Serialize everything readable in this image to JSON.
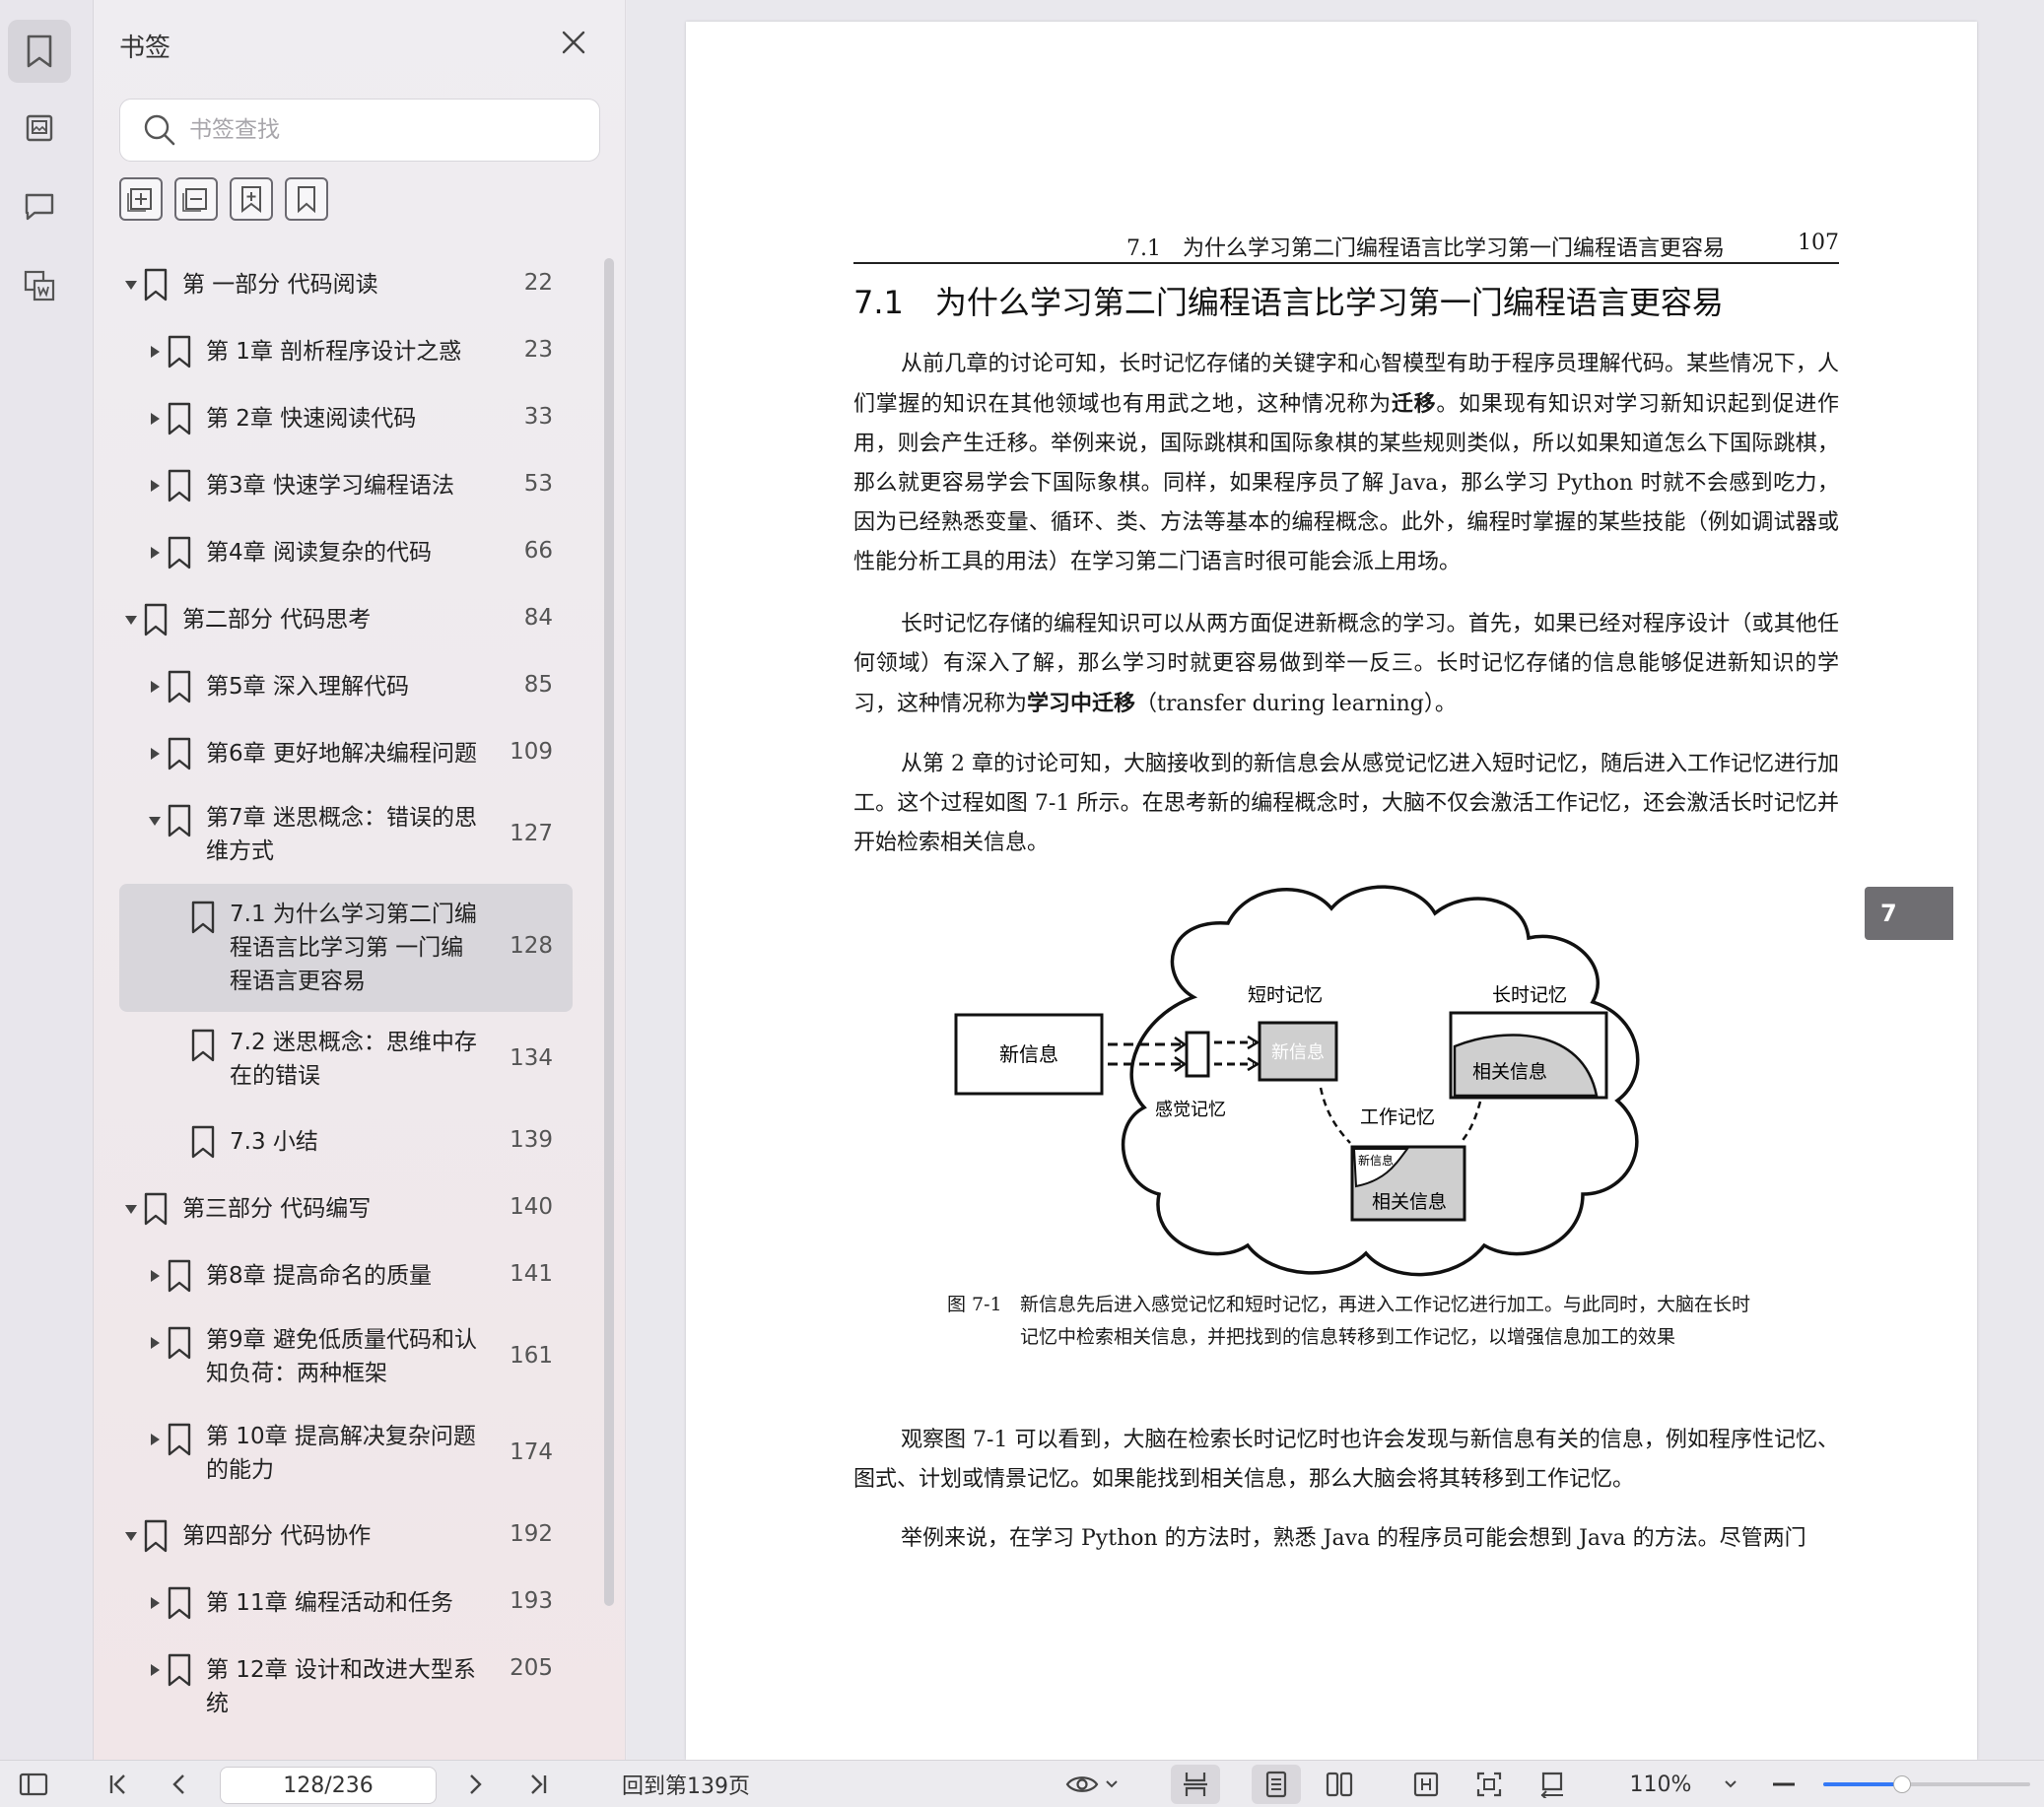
{
  "rail": {
    "items": [
      {
        "name": "bookmark-icon",
        "active": true
      },
      {
        "name": "thumbnail-icon",
        "active": false
      },
      {
        "name": "comment-icon",
        "active": false
      },
      {
        "name": "extract-icon",
        "active": false
      }
    ]
  },
  "sidebar": {
    "title": "书签",
    "search_placeholder": "书签查找",
    "tools": [
      "expand-all-icon",
      "collapse-all-icon",
      "add-bookmark-icon",
      "bookmark-icon"
    ],
    "items": [
      {
        "level": 0,
        "expanded": true,
        "label": "第 一部分 代码阅读",
        "page": "22"
      },
      {
        "level": 1,
        "expanded": false,
        "label": "第 1章 剖析程序设计之惑",
        "page": "23"
      },
      {
        "level": 1,
        "expanded": false,
        "label": "第 2章 快速阅读代码",
        "page": "33"
      },
      {
        "level": 1,
        "expanded": false,
        "label": "第3章 快速学习编程语法",
        "page": "53"
      },
      {
        "level": 1,
        "expanded": false,
        "label": "第4章 阅读复杂的代码",
        "page": "66"
      },
      {
        "level": 0,
        "expanded": true,
        "label": "第二部分 代码思考",
        "page": "84"
      },
      {
        "level": 1,
        "expanded": false,
        "label": "第5章 深入理解代码",
        "page": "85"
      },
      {
        "level": 1,
        "expanded": false,
        "label": "第6章 更好地解决编程问题",
        "page": "109"
      },
      {
        "level": 1,
        "expanded": true,
        "label": "第7章 迷思概念：错误的思维方式",
        "page": "127"
      },
      {
        "level": 2,
        "selected": true,
        "label": "7.1 为什么学习第二门编程语言比学习第 一门编程语言更容易",
        "page": "128"
      },
      {
        "level": 2,
        "label": "7.2 迷思概念：思维中存在的错误",
        "page": "134"
      },
      {
        "level": 2,
        "label": "7.3 小结",
        "page": "139"
      },
      {
        "level": 0,
        "expanded": true,
        "label": "第三部分 代码编写",
        "page": "140"
      },
      {
        "level": 1,
        "expanded": false,
        "label": "第8章 提高命名的质量",
        "page": "141"
      },
      {
        "level": 1,
        "expanded": false,
        "label": "第9章 避免低质量代码和认知负荷：两种框架",
        "page": "161"
      },
      {
        "level": 1,
        "expanded": false,
        "label": "第 10章 提高解决复杂问题的能力",
        "page": "174"
      },
      {
        "level": 0,
        "expanded": true,
        "label": "第四部分 代码协作",
        "page": "192"
      },
      {
        "level": 1,
        "expanded": false,
        "label": "第 11章 编程活动和任务",
        "page": "193"
      },
      {
        "level": 1,
        "expanded": false,
        "label": "第 12章 设计和改进大型系统",
        "page": "205"
      }
    ]
  },
  "document": {
    "running_head": "7.1　为什么学习第二门编程语言比学习第一门编程语言更容易",
    "page_number": "107",
    "section_title": "7.1　为什么学习第二门编程语言比学习第一门编程语言更容易",
    "chapter_tab": "7",
    "paragraphs": [
      [
        "从前几章的讨论可知，长时记忆存储的关键字和心智模型有助于程序员理解代码。某些情况下，人们掌握的知识在其他领域也有用武之地，这种情况称为",
        "迁移",
        "。如果现有知识对学习新知识起到促进作用，则会产生迁移。举例来说，国际跳棋和国际象棋的某些规则类似，所以如果知道怎么下国际跳棋，那么就更容易学会下国际象棋。同样，如果程序员了解 Java，那么学习 Python 时就不会感到吃力，因为已经熟悉变量、循环、类、方法等基本的编程概念。此外，编程时掌握的某些技能（例如调试器或性能分析工具的用法）在学习第二门语言时很可能会派上用场。"
      ],
      [
        "长时记忆存储的编程知识可以从两方面促进新概念的学习。首先，如果已经对程序设计（或其他任何领域）有深入了解，那么学习时就更容易做到举一反三。长时记忆存储的信息能够促进新知识的学习，这种情况称为",
        "学习中迁移",
        "（transfer during learning）。"
      ],
      [
        "从第 2 章的讨论可知，大脑接收到的新信息会从感觉记忆进入短时记忆，随后进入工作记忆进行加工。这个过程如图 7-1 所示。在思考新的编程概念时，大脑不仅会激活工作记忆，还会激活长时记忆并开始检索相关信息。",
        "",
        ""
      ],
      [
        "观察图 7-1 可以看到，大脑在检索长时记忆时也许会发现与新信息有关的信息，例如程序性记忆、图式、计划或情景记忆。如果能找到相关信息，那么大脑会将其转移到工作记忆。",
        "",
        ""
      ],
      [
        "举例来说，在学习 Python 的方法时，熟悉 Java 的程序员可能会想到 Java 的方法。尽管两门",
        "",
        ""
      ]
    ],
    "figure": {
      "new_info": "新信息",
      "short_term": "短时记忆",
      "short_term_box": "新信息",
      "sensory": "感觉记忆",
      "long_term": "长时记忆",
      "long_term_box": "相关信息",
      "working": "工作记忆",
      "working_small": "新信息",
      "working_box": "相关信息"
    },
    "caption_no": "图 7-1",
    "caption": "新信息先后进入感觉记忆和短时记忆，再进入工作记忆进行加工。与此同时，大脑在长时记忆中检索相关信息，并把找到的信息转移到工作记忆，以增强信息加工的效果"
  },
  "statusbar": {
    "page_field": "128/236",
    "goto_label": "回到第139页",
    "zoom": "110%",
    "zoom_level": 0.38
  }
}
